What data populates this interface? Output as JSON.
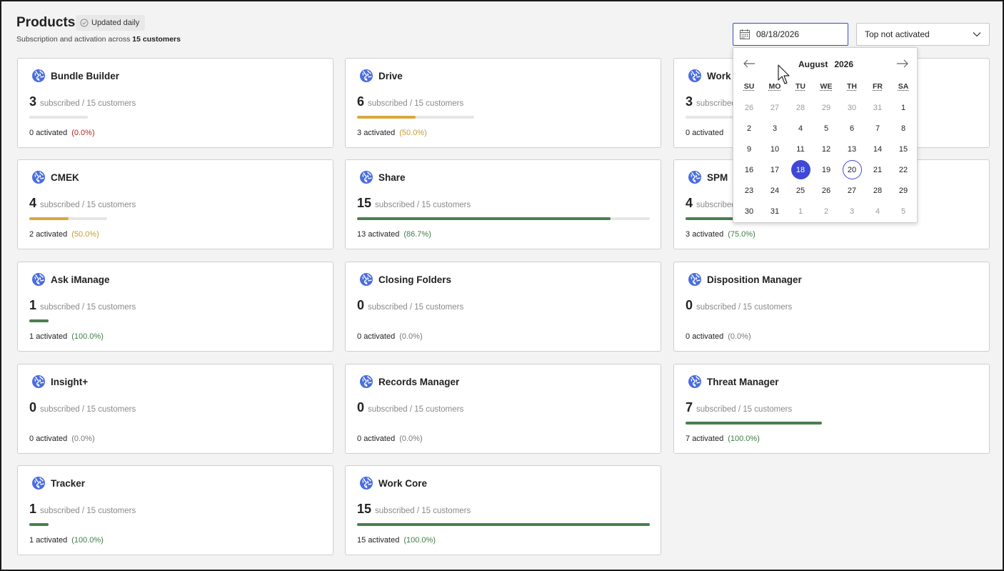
{
  "header": {
    "title": "Products",
    "badge": "Updated daily",
    "subtitle_prefix": "Subscription and activation across ",
    "subtitle_count": "15 customers"
  },
  "controls": {
    "date_value": "08/18/2026",
    "sort_value": "Top not activated"
  },
  "labels": {
    "subscribed_suffix": "subscribed / 15 customers",
    "activated_suffix": "activated"
  },
  "colors": {
    "accent": "#3f48d8",
    "green": "#3e7d45",
    "amber": "#d9a83b",
    "red": "#b3261e"
  },
  "products": [
    {
      "name": "Bundle Builder",
      "subscribed": "3",
      "activated": "0",
      "percent": "(0.0%)",
      "subscribed_fraction": 0.2,
      "activated_fraction": 0.0,
      "status": "red"
    },
    {
      "name": "Drive",
      "subscribed": "6",
      "activated": "3",
      "percent": "(50.0%)",
      "subscribed_fraction": 0.4,
      "activated_fraction": 0.5,
      "status": "amber"
    },
    {
      "name": "Work",
      "subscribed": "3",
      "activated": "0",
      "percent": "",
      "subscribed_fraction": 0.2,
      "activated_fraction": 0.0,
      "status": "gray"
    },
    {
      "name": "CMEK",
      "subscribed": "4",
      "activated": "2",
      "percent": "(50.0%)",
      "subscribed_fraction": 0.267,
      "activated_fraction": 0.5,
      "status": "amber"
    },
    {
      "name": "Share",
      "subscribed": "15",
      "activated": "13",
      "percent": "(86.7%)",
      "subscribed_fraction": 1.0,
      "activated_fraction": 0.867,
      "status": "green"
    },
    {
      "name": "SPM",
      "subscribed": "4",
      "activated": "3",
      "percent": "(75.0%)",
      "subscribed_fraction": 0.267,
      "activated_fraction": 0.75,
      "status": "green"
    },
    {
      "name": "Ask iManage",
      "subscribed": "1",
      "activated": "1",
      "percent": "(100.0%)",
      "subscribed_fraction": 0.067,
      "activated_fraction": 1.0,
      "status": "green"
    },
    {
      "name": "Closing Folders",
      "subscribed": "0",
      "activated": "0",
      "percent": "(0.0%)",
      "subscribed_fraction": 0.0,
      "activated_fraction": 0.0,
      "status": "gray"
    },
    {
      "name": "Disposition Manager",
      "subscribed": "0",
      "activated": "0",
      "percent": "(0.0%)",
      "subscribed_fraction": 0.0,
      "activated_fraction": 0.0,
      "status": "gray"
    },
    {
      "name": "Insight+",
      "subscribed": "0",
      "activated": "0",
      "percent": "(0.0%)",
      "subscribed_fraction": 0.0,
      "activated_fraction": 0.0,
      "status": "gray"
    },
    {
      "name": "Records Manager",
      "subscribed": "0",
      "activated": "0",
      "percent": "(0.0%)",
      "subscribed_fraction": 0.0,
      "activated_fraction": 0.0,
      "status": "gray"
    },
    {
      "name": "Threat Manager",
      "subscribed": "7",
      "activated": "7",
      "percent": "(100.0%)",
      "subscribed_fraction": 0.467,
      "activated_fraction": 1.0,
      "status": "green"
    },
    {
      "name": "Tracker",
      "subscribed": "1",
      "activated": "1",
      "percent": "(100.0%)",
      "subscribed_fraction": 0.067,
      "activated_fraction": 1.0,
      "status": "green"
    },
    {
      "name": "Work Core",
      "subscribed": "15",
      "activated": "15",
      "percent": "(100.0%)",
      "subscribed_fraction": 1.0,
      "activated_fraction": 1.0,
      "status": "green"
    }
  ],
  "calendar": {
    "month": "August",
    "year": "2026",
    "weekdays": [
      "SU",
      "MO",
      "TU",
      "WE",
      "TH",
      "FR",
      "SA"
    ],
    "weeks": [
      [
        "26",
        "27",
        "28",
        "29",
        "30",
        "31",
        "1"
      ],
      [
        "2",
        "3",
        "4",
        "5",
        "6",
        "7",
        "8"
      ],
      [
        "9",
        "10",
        "11",
        "12",
        "13",
        "14",
        "15"
      ],
      [
        "16",
        "17",
        "18",
        "19",
        "20",
        "21",
        "22"
      ],
      [
        "23",
        "24",
        "25",
        "26",
        "27",
        "28",
        "29"
      ],
      [
        "30",
        "31",
        "1",
        "2",
        "3",
        "4",
        "5"
      ]
    ],
    "selected_day": "18",
    "today_day": "20"
  }
}
